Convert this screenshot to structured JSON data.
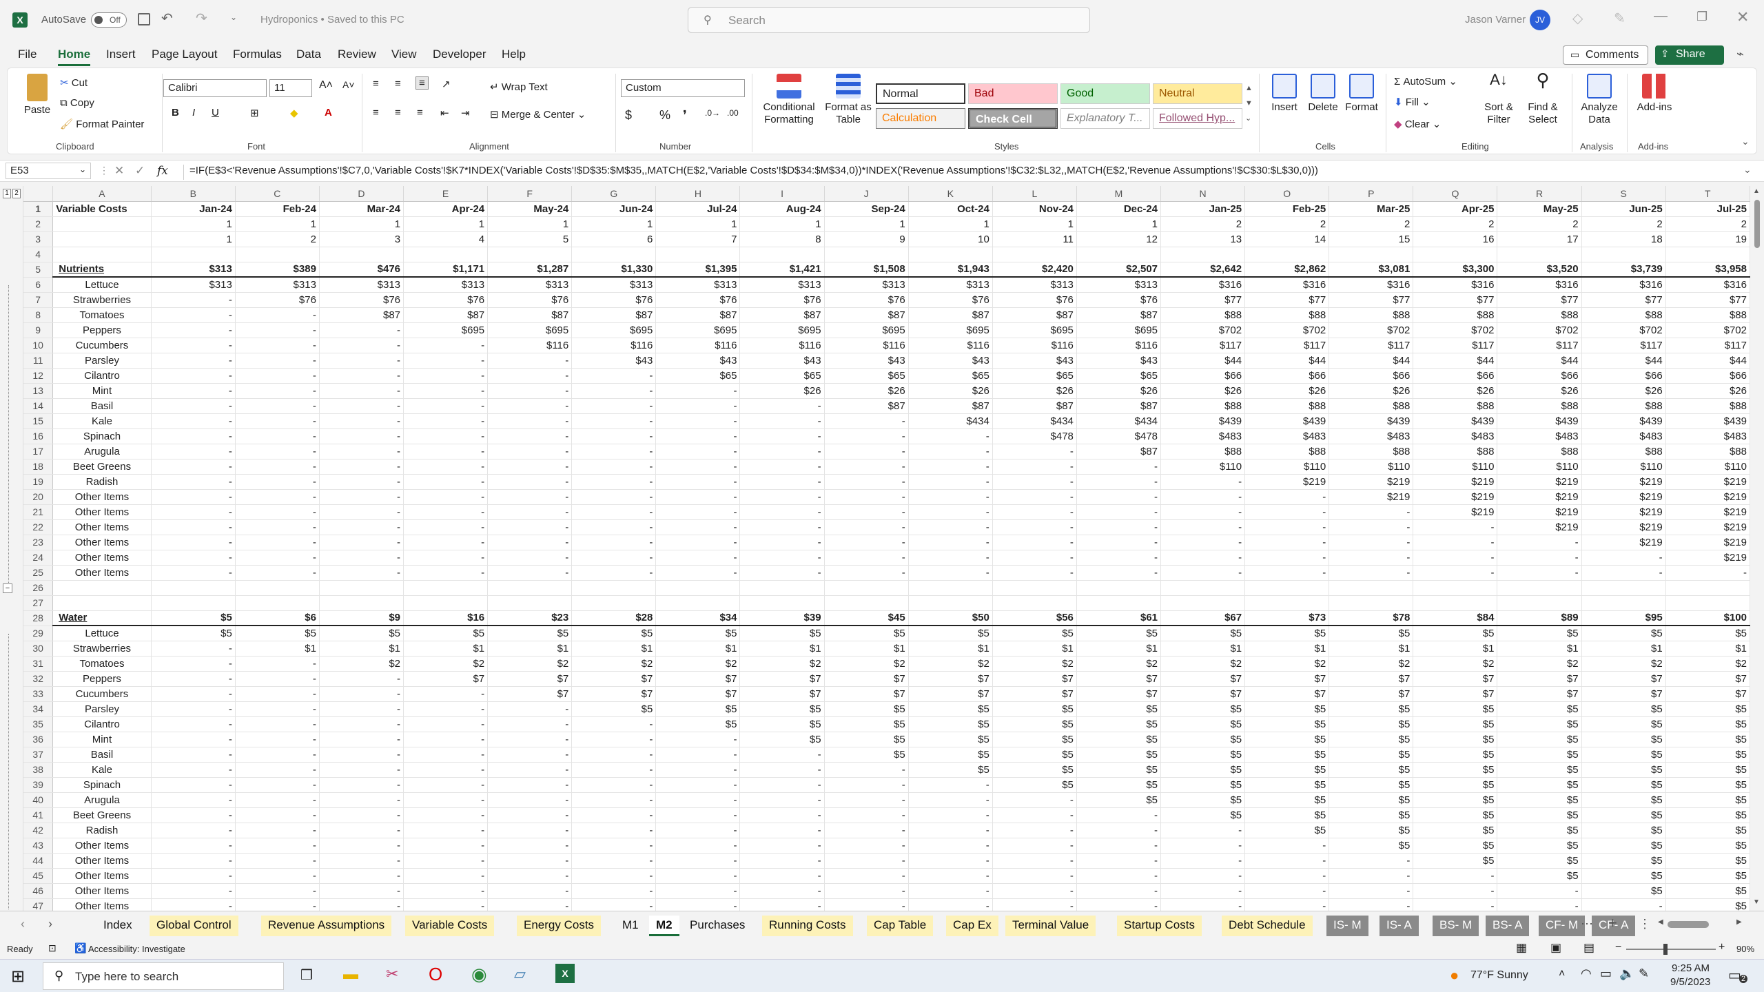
{
  "titlebar": {
    "autosave": "AutoSave",
    "autosave_state": "Off",
    "doc_title": "Hydroponics • Saved to this PC",
    "search_placeholder": "Search",
    "user": "Jason Varner",
    "initials": "JV"
  },
  "menu": [
    "File",
    "Home",
    "Insert",
    "Page Layout",
    "Formulas",
    "Data",
    "Review",
    "View",
    "Developer",
    "Help"
  ],
  "menu_right": {
    "comments": "Comments",
    "share": "Share"
  },
  "ribbon": {
    "clipboard": {
      "paste": "Paste",
      "cut": "Cut",
      "copy": "Copy",
      "format_painter": "Format Painter",
      "group": "Clipboard"
    },
    "font": {
      "name": "Calibri",
      "size": "11",
      "group": "Font"
    },
    "alignment": {
      "wrap": "Wrap Text",
      "merge": "Merge & Center",
      "group": "Alignment"
    },
    "number": {
      "format": "Custom",
      "group": "Number"
    },
    "styles": {
      "cond": "Conditional Formatting",
      "fmt_table": "Format as Table",
      "normal": "Normal",
      "bad": "Bad",
      "good": "Good",
      "neutral": "Neutral",
      "calc": "Calculation",
      "check": "Check Cell",
      "explanatory": "Explanatory T...",
      "followed": "Followed Hyp...",
      "group": "Styles"
    },
    "cells": {
      "insert": "Insert",
      "delete": "Delete",
      "format": "Format",
      "group": "Cells"
    },
    "editing": {
      "autosum": "AutoSum",
      "fill": "Fill",
      "clear": "Clear",
      "sort": "Sort & Filter",
      "find": "Find & Select",
      "group": "Editing"
    },
    "analysis": {
      "analyze": "Analyze Data",
      "group": "Analysis"
    },
    "addins": {
      "addins": "Add-ins",
      "group": "Add-ins"
    }
  },
  "formula_bar": {
    "namebox": "E53",
    "fx": "fx",
    "formula": "=IF(E$3<'Revenue Assumptions'!$C7,0,'Variable Costs'!$K7*INDEX('Variable Costs'!$D$35:$M$35,,MATCH(E$2,'Variable Costs'!$D$34:$M$34,0))*INDEX('Revenue Assumptions'!$C32:$L32,,MATCH(E$2,'Revenue Assumptions'!$C$30:$L$30,0)))"
  },
  "columns": [
    "A",
    "B",
    "C",
    "D",
    "E",
    "F",
    "G",
    "H",
    "I",
    "J",
    "K",
    "L",
    "M",
    "N",
    "O",
    "P",
    "Q",
    "R",
    "S",
    "T"
  ],
  "rows": [
    {
      "n": "1",
      "type": "hdr",
      "cells": [
        "Variable Costs",
        "Jan-24",
        "Feb-24",
        "Mar-24",
        "Apr-24",
        "May-24",
        "Jun-24",
        "Jul-24",
        "Aug-24",
        "Sep-24",
        "Oct-24",
        "Nov-24",
        "Dec-24",
        "Jan-25",
        "Feb-25",
        "Mar-25",
        "Apr-25",
        "May-25",
        "Jun-25",
        "Jul-25"
      ]
    },
    {
      "n": "2",
      "cells": [
        "",
        "1",
        "1",
        "1",
        "1",
        "1",
        "1",
        "1",
        "1",
        "1",
        "1",
        "1",
        "1",
        "2",
        "2",
        "2",
        "2",
        "2",
        "2",
        "2"
      ]
    },
    {
      "n": "3",
      "cells": [
        "",
        "1",
        "2",
        "3",
        "4",
        "5",
        "6",
        "7",
        "8",
        "9",
        "10",
        "11",
        "12",
        "13",
        "14",
        "15",
        "16",
        "17",
        "18",
        "19"
      ]
    },
    {
      "n": "4",
      "cells": [
        "",
        "",
        "",
        "",
        "",
        "",
        "",
        "",
        "",
        "",
        "",
        "",
        "",
        "",
        "",
        "",
        "",
        "",
        "",
        ""
      ]
    },
    {
      "n": "5",
      "type": "section",
      "cells": [
        "Nutrients",
        "$313",
        "$389",
        "$476",
        "$1,171",
        "$1,287",
        "$1,330",
        "$1,395",
        "$1,421",
        "$1,508",
        "$1,943",
        "$2,420",
        "$2,507",
        "$2,642",
        "$2,862",
        "$3,081",
        "$3,300",
        "$3,520",
        "$3,739",
        "$3,958"
      ]
    },
    {
      "n": "6",
      "cells": [
        "Lettuce",
        "$313",
        "$313",
        "$313",
        "$313",
        "$313",
        "$313",
        "$313",
        "$313",
        "$313",
        "$313",
        "$313",
        "$313",
        "$316",
        "$316",
        "$316",
        "$316",
        "$316",
        "$316",
        "$316"
      ]
    },
    {
      "n": "7",
      "cells": [
        "Strawberries",
        "-",
        "$76",
        "$76",
        "$76",
        "$76",
        "$76",
        "$76",
        "$76",
        "$76",
        "$76",
        "$76",
        "$76",
        "$77",
        "$77",
        "$77",
        "$77",
        "$77",
        "$77",
        "$77"
      ]
    },
    {
      "n": "8",
      "cells": [
        "Tomatoes",
        "-",
        "-",
        "$87",
        "$87",
        "$87",
        "$87",
        "$87",
        "$87",
        "$87",
        "$87",
        "$87",
        "$87",
        "$88",
        "$88",
        "$88",
        "$88",
        "$88",
        "$88",
        "$88"
      ]
    },
    {
      "n": "9",
      "cells": [
        "Peppers",
        "-",
        "-",
        "-",
        "$695",
        "$695",
        "$695",
        "$695",
        "$695",
        "$695",
        "$695",
        "$695",
        "$695",
        "$702",
        "$702",
        "$702",
        "$702",
        "$702",
        "$702",
        "$702"
      ]
    },
    {
      "n": "10",
      "cells": [
        "Cucumbers",
        "-",
        "-",
        "-",
        "-",
        "$116",
        "$116",
        "$116",
        "$116",
        "$116",
        "$116",
        "$116",
        "$116",
        "$117",
        "$117",
        "$117",
        "$117",
        "$117",
        "$117",
        "$117"
      ]
    },
    {
      "n": "11",
      "cells": [
        "Parsley",
        "-",
        "-",
        "-",
        "-",
        "-",
        "$43",
        "$43",
        "$43",
        "$43",
        "$43",
        "$43",
        "$43",
        "$44",
        "$44",
        "$44",
        "$44",
        "$44",
        "$44",
        "$44"
      ]
    },
    {
      "n": "12",
      "cells": [
        "Cilantro",
        "-",
        "-",
        "-",
        "-",
        "-",
        "-",
        "$65",
        "$65",
        "$65",
        "$65",
        "$65",
        "$65",
        "$66",
        "$66",
        "$66",
        "$66",
        "$66",
        "$66",
        "$66"
      ]
    },
    {
      "n": "13",
      "cells": [
        "Mint",
        "-",
        "-",
        "-",
        "-",
        "-",
        "-",
        "-",
        "$26",
        "$26",
        "$26",
        "$26",
        "$26",
        "$26",
        "$26",
        "$26",
        "$26",
        "$26",
        "$26",
        "$26"
      ]
    },
    {
      "n": "14",
      "cells": [
        "Basil",
        "-",
        "-",
        "-",
        "-",
        "-",
        "-",
        "-",
        "-",
        "$87",
        "$87",
        "$87",
        "$87",
        "$88",
        "$88",
        "$88",
        "$88",
        "$88",
        "$88",
        "$88"
      ]
    },
    {
      "n": "15",
      "cells": [
        "Kale",
        "-",
        "-",
        "-",
        "-",
        "-",
        "-",
        "-",
        "-",
        "-",
        "$434",
        "$434",
        "$434",
        "$439",
        "$439",
        "$439",
        "$439",
        "$439",
        "$439",
        "$439"
      ]
    },
    {
      "n": "16",
      "cells": [
        "Spinach",
        "-",
        "-",
        "-",
        "-",
        "-",
        "-",
        "-",
        "-",
        "-",
        "-",
        "$478",
        "$478",
        "$483",
        "$483",
        "$483",
        "$483",
        "$483",
        "$483",
        "$483"
      ]
    },
    {
      "n": "17",
      "cells": [
        "Arugula",
        "-",
        "-",
        "-",
        "-",
        "-",
        "-",
        "-",
        "-",
        "-",
        "-",
        "-",
        "$87",
        "$88",
        "$88",
        "$88",
        "$88",
        "$88",
        "$88",
        "$88"
      ]
    },
    {
      "n": "18",
      "cells": [
        "Beet Greens",
        "-",
        "-",
        "-",
        "-",
        "-",
        "-",
        "-",
        "-",
        "-",
        "-",
        "-",
        "-",
        "$110",
        "$110",
        "$110",
        "$110",
        "$110",
        "$110",
        "$110"
      ]
    },
    {
      "n": "19",
      "cells": [
        "Radish",
        "-",
        "-",
        "-",
        "-",
        "-",
        "-",
        "-",
        "-",
        "-",
        "-",
        "-",
        "-",
        "-",
        "$219",
        "$219",
        "$219",
        "$219",
        "$219",
        "$219"
      ]
    },
    {
      "n": "20",
      "cells": [
        "Other Items",
        "-",
        "-",
        "-",
        "-",
        "-",
        "-",
        "-",
        "-",
        "-",
        "-",
        "-",
        "-",
        "-",
        "-",
        "$219",
        "$219",
        "$219",
        "$219",
        "$219"
      ]
    },
    {
      "n": "21",
      "cells": [
        "Other Items",
        "-",
        "-",
        "-",
        "-",
        "-",
        "-",
        "-",
        "-",
        "-",
        "-",
        "-",
        "-",
        "-",
        "-",
        "-",
        "$219",
        "$219",
        "$219",
        "$219"
      ]
    },
    {
      "n": "22",
      "cells": [
        "Other Items",
        "-",
        "-",
        "-",
        "-",
        "-",
        "-",
        "-",
        "-",
        "-",
        "-",
        "-",
        "-",
        "-",
        "-",
        "-",
        "-",
        "$219",
        "$219",
        "$219"
      ]
    },
    {
      "n": "23",
      "cells": [
        "Other Items",
        "-",
        "-",
        "-",
        "-",
        "-",
        "-",
        "-",
        "-",
        "-",
        "-",
        "-",
        "-",
        "-",
        "-",
        "-",
        "-",
        "-",
        "$219",
        "$219"
      ]
    },
    {
      "n": "24",
      "cells": [
        "Other Items",
        "-",
        "-",
        "-",
        "-",
        "-",
        "-",
        "-",
        "-",
        "-",
        "-",
        "-",
        "-",
        "-",
        "-",
        "-",
        "-",
        "-",
        "-",
        "$219"
      ]
    },
    {
      "n": "25",
      "cells": [
        "Other Items",
        "-",
        "-",
        "-",
        "-",
        "-",
        "-",
        "-",
        "-",
        "-",
        "-",
        "-",
        "-",
        "-",
        "-",
        "-",
        "-",
        "-",
        "-",
        "-"
      ]
    },
    {
      "n": "26",
      "cells": [
        "",
        "",
        "",
        "",
        "",
        "",
        "",
        "",
        "",
        "",
        "",
        "",
        "",
        "",
        "",
        "",
        "",
        "",
        "",
        ""
      ]
    },
    {
      "n": "27",
      "cells": [
        "",
        "",
        "",
        "",
        "",
        "",
        "",
        "",
        "",
        "",
        "",
        "",
        "",
        "",
        "",
        "",
        "",
        "",
        "",
        ""
      ]
    },
    {
      "n": "28",
      "type": "section",
      "cells": [
        "Water",
        "$5",
        "$6",
        "$9",
        "$16",
        "$23",
        "$28",
        "$34",
        "$39",
        "$45",
        "$50",
        "$56",
        "$61",
        "$67",
        "$73",
        "$78",
        "$84",
        "$89",
        "$95",
        "$100"
      ]
    },
    {
      "n": "29",
      "cells": [
        "Lettuce",
        "$5",
        "$5",
        "$5",
        "$5",
        "$5",
        "$5",
        "$5",
        "$5",
        "$5",
        "$5",
        "$5",
        "$5",
        "$5",
        "$5",
        "$5",
        "$5",
        "$5",
        "$5",
        "$5"
      ]
    },
    {
      "n": "30",
      "cells": [
        "Strawberries",
        "-",
        "$1",
        "$1",
        "$1",
        "$1",
        "$1",
        "$1",
        "$1",
        "$1",
        "$1",
        "$1",
        "$1",
        "$1",
        "$1",
        "$1",
        "$1",
        "$1",
        "$1",
        "$1"
      ]
    },
    {
      "n": "31",
      "cells": [
        "Tomatoes",
        "-",
        "-",
        "$2",
        "$2",
        "$2",
        "$2",
        "$2",
        "$2",
        "$2",
        "$2",
        "$2",
        "$2",
        "$2",
        "$2",
        "$2",
        "$2",
        "$2",
        "$2",
        "$2"
      ]
    },
    {
      "n": "32",
      "cells": [
        "Peppers",
        "-",
        "-",
        "-",
        "$7",
        "$7",
        "$7",
        "$7",
        "$7",
        "$7",
        "$7",
        "$7",
        "$7",
        "$7",
        "$7",
        "$7",
        "$7",
        "$7",
        "$7",
        "$7"
      ]
    },
    {
      "n": "33",
      "cells": [
        "Cucumbers",
        "-",
        "-",
        "-",
        "-",
        "$7",
        "$7",
        "$7",
        "$7",
        "$7",
        "$7",
        "$7",
        "$7",
        "$7",
        "$7",
        "$7",
        "$7",
        "$7",
        "$7",
        "$7"
      ]
    },
    {
      "n": "34",
      "cells": [
        "Parsley",
        "-",
        "-",
        "-",
        "-",
        "-",
        "$5",
        "$5",
        "$5",
        "$5",
        "$5",
        "$5",
        "$5",
        "$5",
        "$5",
        "$5",
        "$5",
        "$5",
        "$5",
        "$5"
      ]
    },
    {
      "n": "35",
      "cells": [
        "Cilantro",
        "-",
        "-",
        "-",
        "-",
        "-",
        "-",
        "$5",
        "$5",
        "$5",
        "$5",
        "$5",
        "$5",
        "$5",
        "$5",
        "$5",
        "$5",
        "$5",
        "$5",
        "$5"
      ]
    },
    {
      "n": "36",
      "cells": [
        "Mint",
        "-",
        "-",
        "-",
        "-",
        "-",
        "-",
        "-",
        "$5",
        "$5",
        "$5",
        "$5",
        "$5",
        "$5",
        "$5",
        "$5",
        "$5",
        "$5",
        "$5",
        "$5"
      ]
    },
    {
      "n": "37",
      "cells": [
        "Basil",
        "-",
        "-",
        "-",
        "-",
        "-",
        "-",
        "-",
        "-",
        "$5",
        "$5",
        "$5",
        "$5",
        "$5",
        "$5",
        "$5",
        "$5",
        "$5",
        "$5",
        "$5"
      ]
    },
    {
      "n": "38",
      "cells": [
        "Kale",
        "-",
        "-",
        "-",
        "-",
        "-",
        "-",
        "-",
        "-",
        "-",
        "$5",
        "$5",
        "$5",
        "$5",
        "$5",
        "$5",
        "$5",
        "$5",
        "$5",
        "$5"
      ]
    },
    {
      "n": "39",
      "cells": [
        "Spinach",
        "-",
        "-",
        "-",
        "-",
        "-",
        "-",
        "-",
        "-",
        "-",
        "-",
        "$5",
        "$5",
        "$5",
        "$5",
        "$5",
        "$5",
        "$5",
        "$5",
        "$5"
      ]
    },
    {
      "n": "40",
      "cells": [
        "Arugula",
        "-",
        "-",
        "-",
        "-",
        "-",
        "-",
        "-",
        "-",
        "-",
        "-",
        "-",
        "$5",
        "$5",
        "$5",
        "$5",
        "$5",
        "$5",
        "$5",
        "$5"
      ]
    },
    {
      "n": "41",
      "cells": [
        "Beet Greens",
        "-",
        "-",
        "-",
        "-",
        "-",
        "-",
        "-",
        "-",
        "-",
        "-",
        "-",
        "-",
        "$5",
        "$5",
        "$5",
        "$5",
        "$5",
        "$5",
        "$5"
      ]
    },
    {
      "n": "42",
      "cells": [
        "Radish",
        "-",
        "-",
        "-",
        "-",
        "-",
        "-",
        "-",
        "-",
        "-",
        "-",
        "-",
        "-",
        "-",
        "$5",
        "$5",
        "$5",
        "$5",
        "$5",
        "$5"
      ]
    },
    {
      "n": "43",
      "cells": [
        "Other Items",
        "-",
        "-",
        "-",
        "-",
        "-",
        "-",
        "-",
        "-",
        "-",
        "-",
        "-",
        "-",
        "-",
        "-",
        "$5",
        "$5",
        "$5",
        "$5",
        "$5"
      ]
    },
    {
      "n": "44",
      "cells": [
        "Other Items",
        "-",
        "-",
        "-",
        "-",
        "-",
        "-",
        "-",
        "-",
        "-",
        "-",
        "-",
        "-",
        "-",
        "-",
        "-",
        "$5",
        "$5",
        "$5",
        "$5"
      ]
    },
    {
      "n": "45",
      "cells": [
        "Other Items",
        "-",
        "-",
        "-",
        "-",
        "-",
        "-",
        "-",
        "-",
        "-",
        "-",
        "-",
        "-",
        "-",
        "-",
        "-",
        "-",
        "$5",
        "$5",
        "$5"
      ]
    },
    {
      "n": "46",
      "cells": [
        "Other Items",
        "-",
        "-",
        "-",
        "-",
        "-",
        "-",
        "-",
        "-",
        "-",
        "-",
        "-",
        "-",
        "-",
        "-",
        "-",
        "-",
        "-",
        "$5",
        "$5"
      ]
    },
    {
      "n": "47",
      "cells": [
        "Other Items",
        "-",
        "-",
        "-",
        "-",
        "-",
        "-",
        "-",
        "-",
        "-",
        "-",
        "-",
        "-",
        "-",
        "-",
        "-",
        "-",
        "-",
        "-",
        "$5"
      ]
    }
  ],
  "sheets": [
    {
      "name": "Index",
      "style": "wht"
    },
    {
      "name": "Global Control",
      "style": "yel"
    },
    {
      "name": "Revenue Assumptions",
      "style": "yel"
    },
    {
      "name": "Variable Costs",
      "style": "yel"
    },
    {
      "name": "Energy Costs",
      "style": "yel"
    },
    {
      "name": "M1",
      "style": "wht"
    },
    {
      "name": "M2",
      "style": "act"
    },
    {
      "name": "Purchases",
      "style": "wht"
    },
    {
      "name": "Running Costs",
      "style": "yel"
    },
    {
      "name": "Cap Table",
      "style": "yel"
    },
    {
      "name": "Cap Ex",
      "style": "yel"
    },
    {
      "name": "Terminal Value",
      "style": "yel"
    },
    {
      "name": "Startup Costs",
      "style": "yel"
    },
    {
      "name": "Debt Schedule",
      "style": "yel"
    },
    {
      "name": "IS- M",
      "style": "gry"
    },
    {
      "name": "IS- A",
      "style": "gry"
    },
    {
      "name": "BS- M",
      "style": "gry"
    },
    {
      "name": "BS- A",
      "style": "gry"
    },
    {
      "name": "CF- M",
      "style": "gry"
    },
    {
      "name": "CF- A",
      "style": "gry"
    }
  ],
  "status": {
    "ready": "Ready",
    "accessibility": "Accessibility: Investigate",
    "zoom": "90%"
  },
  "taskbar": {
    "search_placeholder": "Type here to search",
    "weather": "77°F  Sunny",
    "time": "9:25 AM",
    "date": "9/5/2023",
    "notif": "2"
  }
}
